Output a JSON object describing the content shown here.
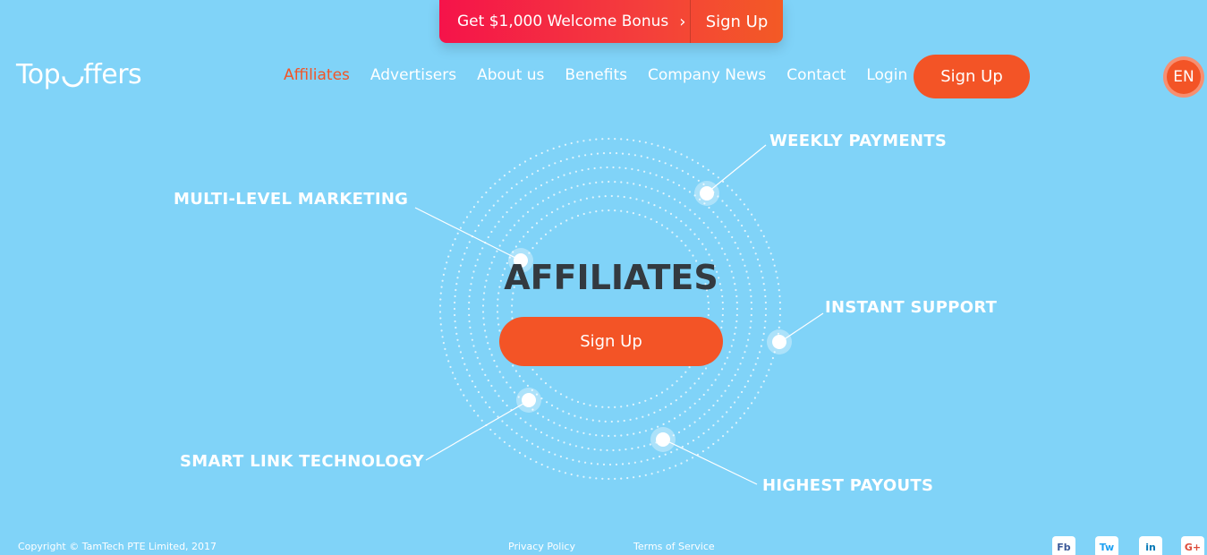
{
  "promo": {
    "bonus_label": "Get $1,000 Welcome Bonus",
    "chevron": "›",
    "signup_label": "Sign Up"
  },
  "header": {
    "logo_part1": "Top",
    "logo_part2": "ffers",
    "nav": [
      "Affiliates",
      "Advertisers",
      "About us",
      "Benefits",
      "Company News",
      "Contact",
      "Login"
    ],
    "signup_label": "Sign Up",
    "language": "EN"
  },
  "hero": {
    "title": "AFFILIATES",
    "signup_label": "Sign Up",
    "features": {
      "weekly": "WEEKLY PAYMENTS",
      "mlm": "MULTI-LEVEL MARKETING",
      "support": "INSTANT SUPPORT",
      "smartlink": "SMART LINK TECHNOLOGY",
      "payouts": "HIGHEST PAYOUTS"
    }
  },
  "footer": {
    "copyright": "Copyright © TamTech PTE Limited, 2017",
    "privacy": "Privacy Policy",
    "terms": "Terms of Service",
    "social": {
      "fb": "Fb",
      "tw": "Tw",
      "in": "in",
      "gplus": "G+"
    }
  },
  "colors": {
    "background": "#80d3f8",
    "accent": "#f35426",
    "title": "#333a40"
  }
}
